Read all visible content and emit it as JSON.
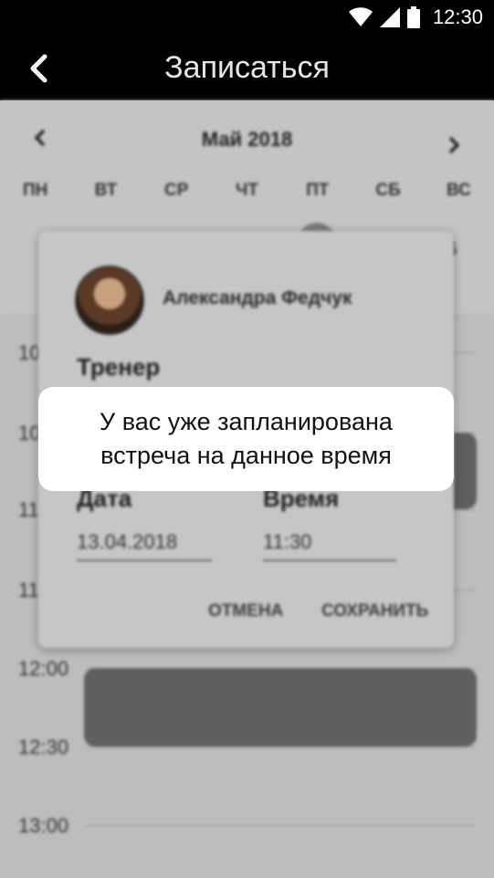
{
  "status_bar": {
    "time": "12:30",
    "icons": [
      "wifi-icon",
      "signal-icon",
      "battery-icon"
    ]
  },
  "app_bar": {
    "title": "Записаться",
    "back_icon": "chevron-left-icon"
  },
  "calendar": {
    "month": "Май 2018",
    "weekdays": [
      "ПН",
      "ВТ",
      "СР",
      "ЧТ",
      "ПТ",
      "СБ",
      "ВС"
    ],
    "visible_day": "6"
  },
  "schedule": {
    "times": [
      "10",
      "10",
      "11",
      "11",
      "12:00",
      "12:30",
      "13:00"
    ]
  },
  "dialog": {
    "trainer_name": "Александра Федчук",
    "role": "Тренер",
    "date_label": "Дата",
    "date_value": "13.04.2018",
    "time_label": "Время",
    "time_value": "11:30",
    "cancel": "ОТМЕНА",
    "save": "СОХРАНИТЬ"
  },
  "toast": {
    "message": "У вас уже запланирована встреча на данное время"
  },
  "colors": {
    "app_bar": "#000000",
    "overlay": "#bdbdbd",
    "event": "#5f5f5f",
    "toast_bg": "#ffffff"
  }
}
